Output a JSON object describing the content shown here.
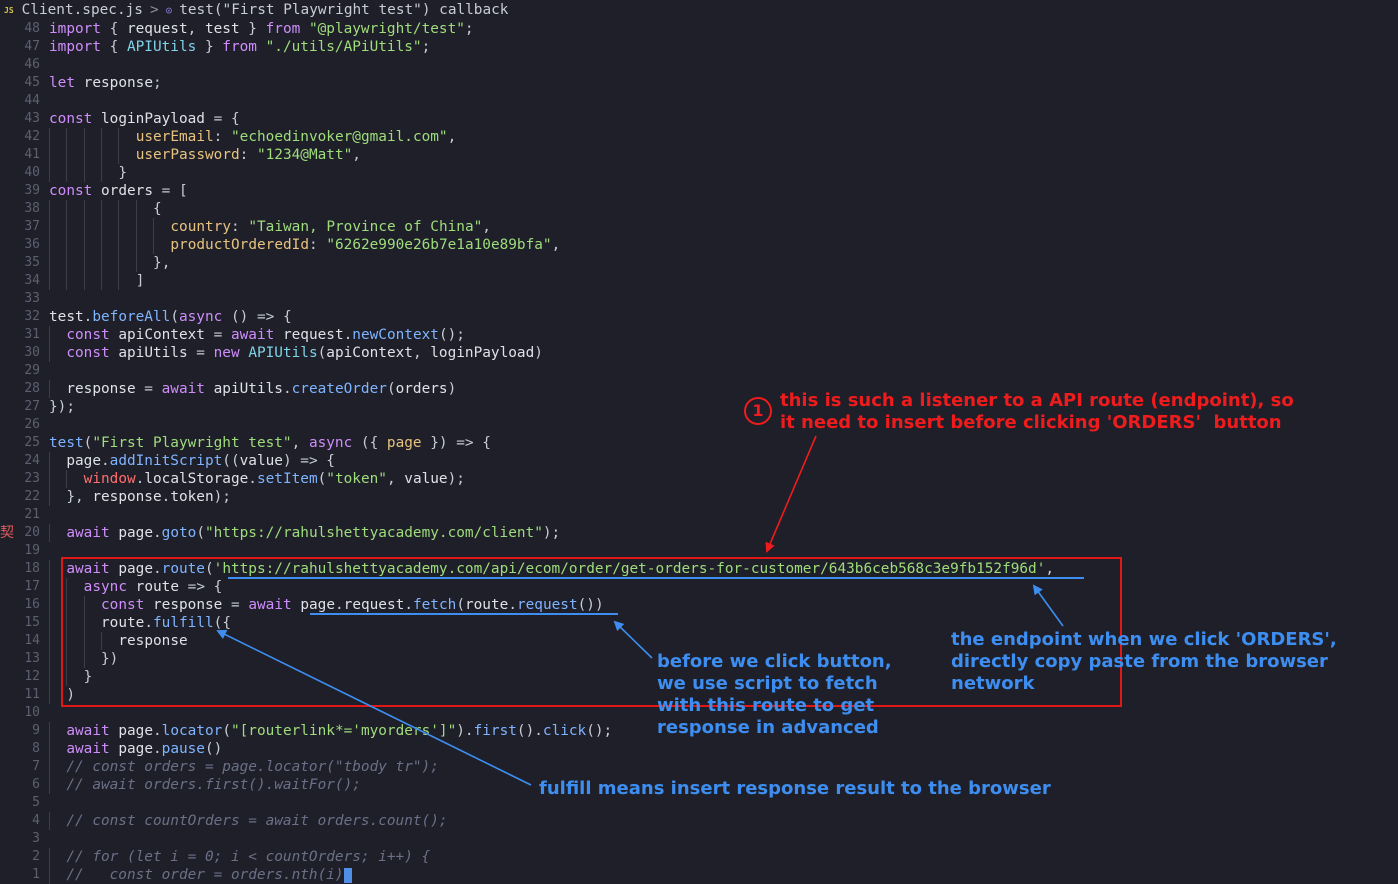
{
  "breadcrumb": {
    "file_badge": "JS",
    "file": "Client.spec.js",
    "separator": ">",
    "symbol": "test(\"First Playwright test\") callback"
  },
  "editor": {
    "gutter_marker": "契",
    "lines": [
      {
        "n": "48",
        "indent": 0,
        "tokens": [
          [
            "kw",
            "import"
          ],
          [
            "punc",
            " { "
          ],
          [
            "var",
            "request"
          ],
          [
            "punc",
            ", "
          ],
          [
            "var",
            "test"
          ],
          [
            "punc",
            " } "
          ],
          [
            "kw",
            "from"
          ],
          [
            "punc",
            " "
          ],
          [
            "str",
            "\"@playwright/test\""
          ],
          [
            "punc",
            ";"
          ]
        ]
      },
      {
        "n": "47",
        "indent": 0,
        "tokens": [
          [
            "kw",
            "import"
          ],
          [
            "punc",
            " { "
          ],
          [
            "typ",
            "APIUtils"
          ],
          [
            "punc",
            " } "
          ],
          [
            "kw",
            "from"
          ],
          [
            "punc",
            " "
          ],
          [
            "str",
            "\"./utils/APiUtils\""
          ],
          [
            "punc",
            ";"
          ]
        ]
      },
      {
        "n": "46",
        "indent": 0,
        "tokens": []
      },
      {
        "n": "45",
        "indent": 0,
        "tokens": [
          [
            "kw",
            "let"
          ],
          [
            "punc",
            " "
          ],
          [
            "var",
            "response"
          ],
          [
            "punc",
            ";"
          ]
        ]
      },
      {
        "n": "44",
        "indent": 0,
        "tokens": []
      },
      {
        "n": "43",
        "indent": 0,
        "tokens": [
          [
            "kw",
            "const"
          ],
          [
            "punc",
            " "
          ],
          [
            "var",
            "loginPayload"
          ],
          [
            "punc",
            " = {"
          ]
        ]
      },
      {
        "n": "42",
        "indent": 10,
        "tokens": [
          [
            "prop",
            "userEmail"
          ],
          [
            "punc",
            ": "
          ],
          [
            "str",
            "\"echoedinvoker@gmail.com\""
          ],
          [
            "punc",
            ","
          ]
        ]
      },
      {
        "n": "41",
        "indent": 10,
        "tokens": [
          [
            "prop",
            "userPassword"
          ],
          [
            "punc",
            ": "
          ],
          [
            "str",
            "\"1234@Matt\""
          ],
          [
            "punc",
            ","
          ]
        ]
      },
      {
        "n": "40",
        "indent": 8,
        "tokens": [
          [
            "punc",
            "}"
          ]
        ]
      },
      {
        "n": "39",
        "indent": 0,
        "tokens": [
          [
            "kw",
            "const"
          ],
          [
            "punc",
            " "
          ],
          [
            "var",
            "orders"
          ],
          [
            "punc",
            " = ["
          ]
        ]
      },
      {
        "n": "38",
        "indent": 12,
        "tokens": [
          [
            "punc",
            "{"
          ]
        ]
      },
      {
        "n": "37",
        "indent": 14,
        "tokens": [
          [
            "prop",
            "country"
          ],
          [
            "punc",
            ": "
          ],
          [
            "str",
            "\"Taiwan, Province of China\""
          ],
          [
            "punc",
            ","
          ]
        ]
      },
      {
        "n": "36",
        "indent": 14,
        "tokens": [
          [
            "prop",
            "productOrderedId"
          ],
          [
            "punc",
            ": "
          ],
          [
            "str",
            "\"6262e990e26b7e1a10e89bfa\""
          ],
          [
            "punc",
            ","
          ]
        ]
      },
      {
        "n": "35",
        "indent": 12,
        "tokens": [
          [
            "punc",
            "},"
          ]
        ]
      },
      {
        "n": "34",
        "indent": 10,
        "tokens": [
          [
            "punc",
            "]"
          ]
        ]
      },
      {
        "n": "33",
        "indent": 0,
        "tokens": []
      },
      {
        "n": "32",
        "indent": 0,
        "tokens": [
          [
            "var",
            "test"
          ],
          [
            "punc",
            "."
          ],
          [
            "fn",
            "beforeAll"
          ],
          [
            "punc",
            "("
          ],
          [
            "kw",
            "async"
          ],
          [
            "punc",
            " () => {"
          ]
        ]
      },
      {
        "n": "31",
        "indent": 2,
        "tokens": [
          [
            "kw",
            "const"
          ],
          [
            "punc",
            " "
          ],
          [
            "var",
            "apiContext"
          ],
          [
            "punc",
            " = "
          ],
          [
            "kw",
            "await"
          ],
          [
            "punc",
            " "
          ],
          [
            "var",
            "request"
          ],
          [
            "punc",
            "."
          ],
          [
            "fn",
            "newContext"
          ],
          [
            "punc",
            "();"
          ]
        ]
      },
      {
        "n": "30",
        "indent": 2,
        "tokens": [
          [
            "kw",
            "const"
          ],
          [
            "punc",
            " "
          ],
          [
            "var",
            "apiUtils"
          ],
          [
            "punc",
            " = "
          ],
          [
            "kw",
            "new"
          ],
          [
            "punc",
            " "
          ],
          [
            "typ",
            "APIUtils"
          ],
          [
            "punc",
            "("
          ],
          [
            "var",
            "apiContext"
          ],
          [
            "punc",
            ", "
          ],
          [
            "var",
            "loginPayload"
          ],
          [
            "punc",
            ")"
          ]
        ]
      },
      {
        "n": "29",
        "indent": 0,
        "tokens": []
      },
      {
        "n": "28",
        "indent": 2,
        "tokens": [
          [
            "var",
            "response"
          ],
          [
            "punc",
            " = "
          ],
          [
            "kw",
            "await"
          ],
          [
            "punc",
            " "
          ],
          [
            "var",
            "apiUtils"
          ],
          [
            "punc",
            "."
          ],
          [
            "fn",
            "createOrder"
          ],
          [
            "punc",
            "("
          ],
          [
            "var",
            "orders"
          ],
          [
            "punc",
            ")"
          ]
        ]
      },
      {
        "n": "27",
        "indent": 0,
        "tokens": [
          [
            "punc",
            "});"
          ]
        ]
      },
      {
        "n": "26",
        "indent": 0,
        "tokens": []
      },
      {
        "n": "25",
        "indent": 0,
        "tokens": [
          [
            "fn",
            "test"
          ],
          [
            "punc",
            "("
          ],
          [
            "str",
            "\"First Playwright test\""
          ],
          [
            "punc",
            ", "
          ],
          [
            "kw",
            "async"
          ],
          [
            "punc",
            " ({ "
          ],
          [
            "prop",
            "page"
          ],
          [
            "punc",
            " }) => {"
          ]
        ]
      },
      {
        "n": "24",
        "indent": 2,
        "tokens": [
          [
            "var",
            "page"
          ],
          [
            "punc",
            "."
          ],
          [
            "fn",
            "addInitScript"
          ],
          [
            "punc",
            "(("
          ],
          [
            "var",
            "value"
          ],
          [
            "punc",
            ") => {"
          ]
        ]
      },
      {
        "n": "23",
        "indent": 4,
        "tokens": [
          [
            "red",
            "window"
          ],
          [
            "punc",
            "."
          ],
          [
            "var",
            "localStorage"
          ],
          [
            "punc",
            "."
          ],
          [
            "fn",
            "setItem"
          ],
          [
            "punc",
            "("
          ],
          [
            "str",
            "\"token\""
          ],
          [
            "punc",
            ", "
          ],
          [
            "var",
            "value"
          ],
          [
            "punc",
            ");"
          ]
        ]
      },
      {
        "n": "22",
        "indent": 2,
        "tokens": [
          [
            "punc",
            "}, "
          ],
          [
            "var",
            "response"
          ],
          [
            "punc",
            "."
          ],
          [
            "var",
            "token"
          ],
          [
            "punc",
            ");"
          ]
        ]
      },
      {
        "n": "21",
        "indent": 0,
        "tokens": []
      },
      {
        "n": "20",
        "indent": 2,
        "mark": true,
        "tokens": [
          [
            "kw",
            "await"
          ],
          [
            "punc",
            " "
          ],
          [
            "var",
            "page"
          ],
          [
            "punc",
            "."
          ],
          [
            "fn",
            "goto"
          ],
          [
            "punc",
            "("
          ],
          [
            "str",
            "\"https://rahulshettyacademy.com/client\""
          ],
          [
            "punc",
            ");"
          ]
        ]
      },
      {
        "n": "19",
        "indent": 0,
        "tokens": []
      },
      {
        "n": "18",
        "indent": 2,
        "tokens": [
          [
            "kw",
            "await"
          ],
          [
            "punc",
            " "
          ],
          [
            "var",
            "page"
          ],
          [
            "punc",
            "."
          ],
          [
            "fn",
            "route"
          ],
          [
            "punc",
            "("
          ],
          [
            "str",
            "'https://rahulshettyacademy.com/api/ecom/order/get-orders-for-customer/643b6ceb568c3e9fb152f96d'"
          ],
          [
            "punc",
            ","
          ]
        ]
      },
      {
        "n": "17",
        "indent": 4,
        "tokens": [
          [
            "kw",
            "async"
          ],
          [
            "punc",
            " "
          ],
          [
            "var",
            "route"
          ],
          [
            "punc",
            " => {"
          ]
        ]
      },
      {
        "n": "16",
        "indent": 6,
        "tokens": [
          [
            "kw",
            "const"
          ],
          [
            "punc",
            " "
          ],
          [
            "var",
            "response"
          ],
          [
            "punc",
            " = "
          ],
          [
            "kw",
            "await"
          ],
          [
            "punc",
            " "
          ],
          [
            "var",
            "page"
          ],
          [
            "punc",
            "."
          ],
          [
            "var",
            "request"
          ],
          [
            "punc",
            "."
          ],
          [
            "fn",
            "fetch"
          ],
          [
            "punc",
            "("
          ],
          [
            "var",
            "route"
          ],
          [
            "punc",
            "."
          ],
          [
            "fn",
            "request"
          ],
          [
            "punc",
            "())"
          ]
        ]
      },
      {
        "n": "15",
        "indent": 6,
        "tokens": [
          [
            "var",
            "route"
          ],
          [
            "punc",
            "."
          ],
          [
            "fn",
            "fulfill"
          ],
          [
            "punc",
            "({"
          ]
        ]
      },
      {
        "n": "14",
        "indent": 8,
        "tokens": [
          [
            "var",
            "response"
          ]
        ]
      },
      {
        "n": "13",
        "indent": 6,
        "tokens": [
          [
            "punc",
            "})"
          ]
        ]
      },
      {
        "n": "12",
        "indent": 4,
        "tokens": [
          [
            "punc",
            "}"
          ]
        ]
      },
      {
        "n": "11",
        "indent": 2,
        "tokens": [
          [
            "punc",
            ")"
          ]
        ]
      },
      {
        "n": "10",
        "indent": 0,
        "tokens": []
      },
      {
        "n": "9",
        "indent": 2,
        "tokens": [
          [
            "kw",
            "await"
          ],
          [
            "punc",
            " "
          ],
          [
            "var",
            "page"
          ],
          [
            "punc",
            "."
          ],
          [
            "fn",
            "locator"
          ],
          [
            "punc",
            "("
          ],
          [
            "str",
            "\"[routerlink*='myorders']\""
          ],
          [
            "punc",
            ")."
          ],
          [
            "fn",
            "first"
          ],
          [
            "punc",
            "()."
          ],
          [
            "fn",
            "click"
          ],
          [
            "punc",
            "();"
          ]
        ]
      },
      {
        "n": "8",
        "indent": 2,
        "tokens": [
          [
            "kw",
            "await"
          ],
          [
            "punc",
            " "
          ],
          [
            "var",
            "page"
          ],
          [
            "punc",
            "."
          ],
          [
            "fn",
            "pause"
          ],
          [
            "punc",
            "()"
          ]
        ]
      },
      {
        "n": "7",
        "indent": 2,
        "tokens": [
          [
            "cmt",
            "// const orders = page.locator(\"tbody tr\");"
          ]
        ]
      },
      {
        "n": "6",
        "indent": 2,
        "tokens": [
          [
            "cmt",
            "// await orders.first().waitFor();"
          ]
        ]
      },
      {
        "n": "5",
        "indent": 0,
        "tokens": []
      },
      {
        "n": "4",
        "indent": 2,
        "tokens": [
          [
            "cmt",
            "// const countOrders = await orders.count();"
          ]
        ]
      },
      {
        "n": "3",
        "indent": 0,
        "tokens": []
      },
      {
        "n": "2",
        "indent": 2,
        "tokens": [
          [
            "cmt",
            "// for (let i = 0; i < countOrders; i++) {"
          ]
        ]
      },
      {
        "n": "1",
        "indent": 2,
        "tokens": [
          [
            "cmt",
            "//   const order = orders.nth(i)"
          ]
        ],
        "cursor": true
      }
    ]
  },
  "annotations": {
    "step_number": "1",
    "note_listener": "this is such a listener to a API route (endpoint), so\nit need to insert before clicking 'ORDERS'  button",
    "note_endpoint": "the endpoint when we click 'ORDERS',\ndirectly copy paste from the browser\nnetwork",
    "note_fetch": "before we click button,\nwe use script to fetch\nwith this route to get\nresponse in advanced",
    "note_fulfill": "fulfill means insert response result to the browser"
  },
  "colors": {
    "background": "#1e1f29",
    "annotation_red": "#ee1c1c",
    "annotation_blue": "#3d8ef0"
  }
}
